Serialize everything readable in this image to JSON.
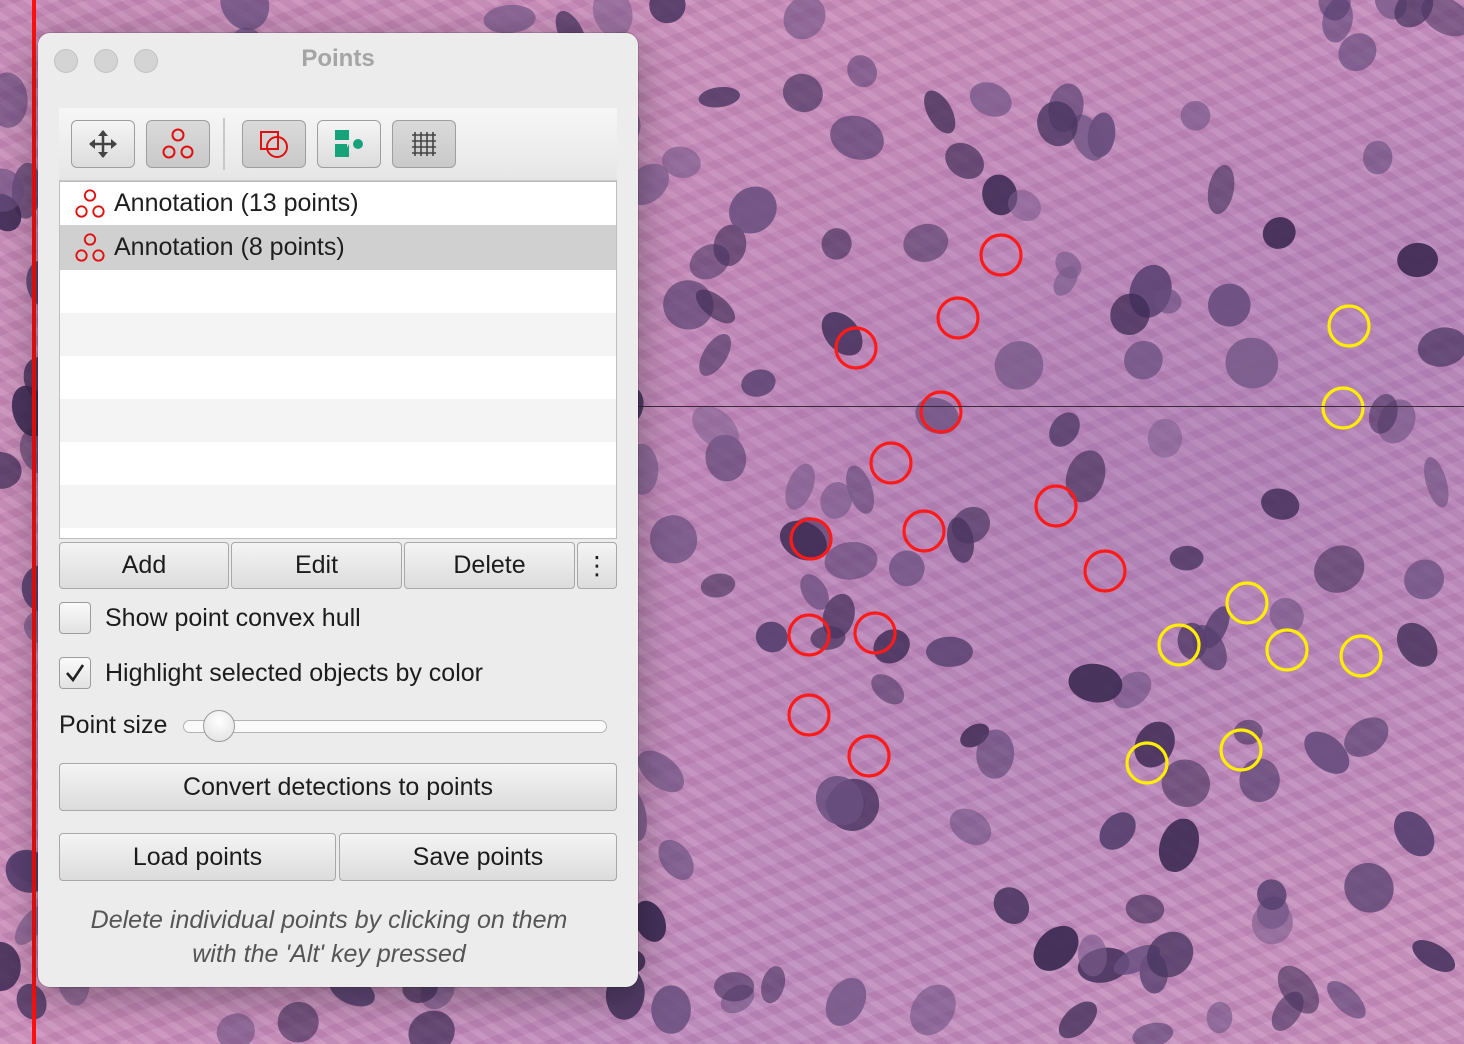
{
  "window": {
    "title": "Points"
  },
  "toolbar": {
    "tools": [
      {
        "name": "move-tool",
        "icon": "move-arrows-icon",
        "active": false
      },
      {
        "name": "points-tool",
        "icon": "points-icon",
        "active": true
      },
      {
        "name": "selection-mode",
        "icon": "selection-shapes-icon",
        "active": true
      },
      {
        "name": "show-classifications",
        "icon": "classification-shapes-icon",
        "active": false
      },
      {
        "name": "grid-tool",
        "icon": "grid-icon",
        "active": true
      }
    ]
  },
  "points_list": {
    "items": [
      {
        "label": "Annotation (13 points)",
        "icon": "points-icon",
        "selected": false
      },
      {
        "label": "Annotation (8 points)",
        "icon": "points-icon",
        "selected": true
      }
    ]
  },
  "actions": {
    "add": "Add",
    "edit": "Edit",
    "delete": "Delete",
    "more": "⋮"
  },
  "options": {
    "show_hull": {
      "label": "Show point convex hull",
      "checked": false
    },
    "highlight": {
      "label": "Highlight selected objects by color",
      "checked": true
    }
  },
  "point_size": {
    "label": "Point size",
    "value": 0.05
  },
  "buttons": {
    "convert": "Convert detections to points",
    "load": "Load points",
    "save": "Save points"
  },
  "hint": {
    "line1": "Delete individual points by clicking on them",
    "line2": "with the 'Alt' key pressed"
  },
  "colors": {
    "red_points": "#ff1a1a",
    "yellow_points": "#ffee00",
    "accent": "#e01010"
  }
}
